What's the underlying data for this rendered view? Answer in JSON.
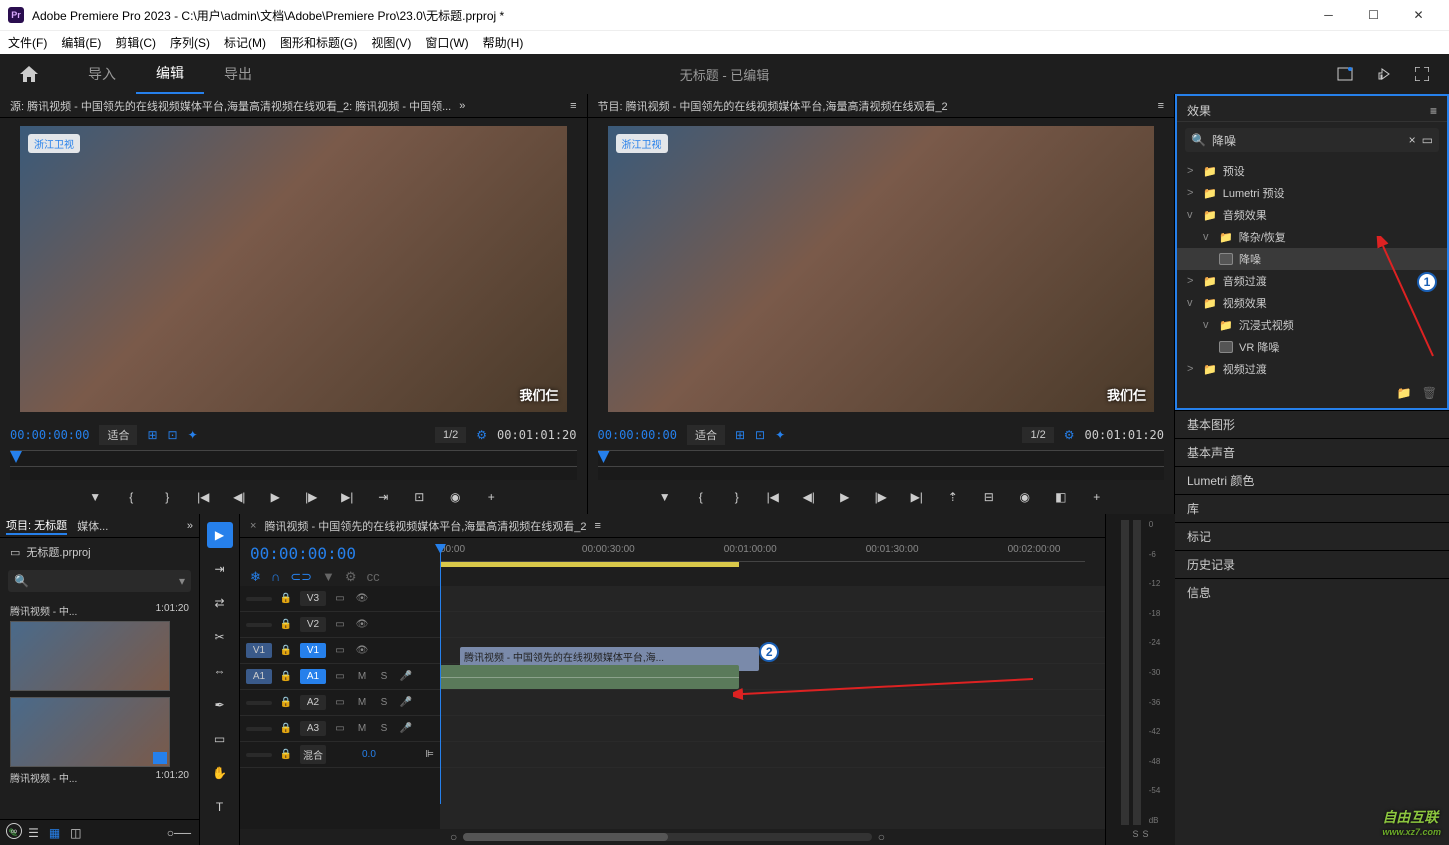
{
  "title": "Adobe Premiere Pro 2023 - C:\\用户\\admin\\文档\\Adobe\\Premiere Pro\\23.0\\无标题.prproj *",
  "menus": [
    "文件(F)",
    "编辑(E)",
    "剪辑(C)",
    "序列(S)",
    "标记(M)",
    "图形和标题(G)",
    "视图(V)",
    "窗口(W)",
    "帮助(H)"
  ],
  "workspace": {
    "tabs": [
      "导入",
      "编辑",
      "导出"
    ],
    "active": "编辑",
    "doc": "无标题 - 已编辑"
  },
  "source": {
    "title": "源: 腾讯视频 - 中国领先的在线视频媒体平台,海量高清视频在线观看_2: 腾讯视频 - 中国领...",
    "tc_left": "00:00:00:00",
    "tc_right": "00:01:01:20",
    "fit": "适合",
    "res": "1/2",
    "logo": "浙江卫视",
    "badge": "我们仨"
  },
  "program": {
    "title": "节目: 腾讯视频 - 中国领先的在线视频媒体平台,海量高清视频在线观看_2",
    "tc_left": "00:00:00:00",
    "tc_right": "00:01:01:20",
    "fit": "适合",
    "res": "1/2",
    "logo": "浙江卫视",
    "badge": "我们仨"
  },
  "project": {
    "tab_project": "项目: 无标题",
    "tab_media": "媒体...",
    "file": "无标题.prproj",
    "bins": [
      {
        "name": "腾讯视频 - 中...",
        "dur": "1:01:20"
      },
      {
        "name": "腾讯视频 - 中...",
        "dur": "1:01:20"
      }
    ]
  },
  "timeline": {
    "seq": "腾讯视频 - 中国领先的在线视频媒体平台,海量高清视频在线观看_2",
    "tc": "00:00:00:00",
    "ticks": [
      "00:00",
      "00:00:30:00",
      "00:01:00:00",
      "00:01:30:00",
      "00:02:00:00"
    ],
    "tracks_v": [
      "V3",
      "V2",
      "V1"
    ],
    "tracks_a": [
      "A1",
      "A2",
      "A3"
    ],
    "mix": "混合",
    "mix_val": "0.0",
    "clip_v": "腾讯视频 - 中国领先的在线视频媒体平台,海...",
    "clip_a": ""
  },
  "meters": {
    "labels": [
      "0",
      "-6",
      "-12",
      "-18",
      "-24",
      "-30",
      "-36",
      "-42",
      "-48",
      "-54",
      "dB"
    ],
    "solo": "S"
  },
  "effects": {
    "title": "效果",
    "search": "降噪",
    "items": [
      {
        "arrow": ">",
        "label": "预设",
        "indent": 0,
        "folder": true
      },
      {
        "arrow": ">",
        "label": "Lumetri 预设",
        "indent": 0,
        "folder": true
      },
      {
        "arrow": "v",
        "label": "音频效果",
        "indent": 0,
        "folder": true
      },
      {
        "arrow": "v",
        "label": "降杂/恢复",
        "indent": 1,
        "folder": true
      },
      {
        "arrow": "",
        "label": "降噪",
        "indent": 2,
        "folder": false,
        "sel": true
      },
      {
        "arrow": ">",
        "label": "音频过渡",
        "indent": 0,
        "folder": true
      },
      {
        "arrow": "v",
        "label": "视频效果",
        "indent": 0,
        "folder": true
      },
      {
        "arrow": "v",
        "label": "沉浸式视频",
        "indent": 1,
        "folder": true
      },
      {
        "arrow": "",
        "label": "VR 降噪",
        "indent": 2,
        "folder": false
      },
      {
        "arrow": ">",
        "label": "视频过渡",
        "indent": 0,
        "folder": true
      }
    ]
  },
  "right_panels": [
    "基本图形",
    "基本声音",
    "Lumetri 颜色",
    "库",
    "标记",
    "历史记录",
    "信息"
  ],
  "watermark_main": "自由互联",
  "watermark_sub": "www.xz7.com"
}
